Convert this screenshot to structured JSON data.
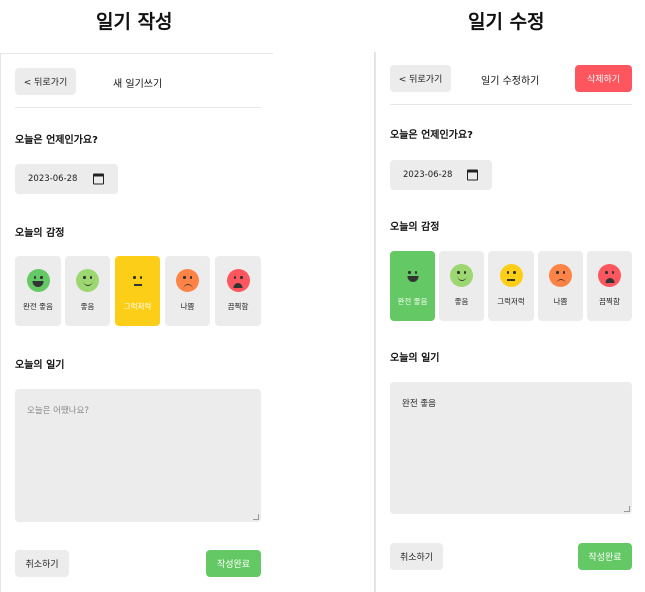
{
  "captions": {
    "new": "일기 작성",
    "edit": "일기 수정"
  },
  "new_page": {
    "back_label": "< 뒤로가기",
    "title": "새 일기쓰기",
    "date_question": "오늘은 언제인가요?",
    "date_value": "2023-06-28",
    "emotion_title": "오늘의 감정",
    "emotions": [
      "완전 좋음",
      "좋음",
      "그럭저럭",
      "나쁨",
      "끔찍함"
    ],
    "selected_emotion": "그럭저럭",
    "diary_title": "오늘의 일기",
    "diary_placeholder": "오늘은 어땠나요?",
    "cancel_label": "취소하기",
    "submit_label": "작성완료"
  },
  "edit_page": {
    "back_label": "< 뒤로가기",
    "title": "일기 수정하기",
    "delete_label": "삭제하기",
    "date_question": "오늘은 언제인가요?",
    "date_value": "2023-06-28",
    "emotion_title": "오늘의 감정",
    "emotions": [
      "완전 좋음",
      "좋음",
      "그럭저럭",
      "나쁨",
      "끔찍함"
    ],
    "selected_emotion": "완전 좋음",
    "diary_title": "오늘의 일기",
    "diary_text": "완전 좋음",
    "cancel_label": "취소하기",
    "submit_label": "작성완료"
  },
  "colors": {
    "emotion_1": "#64c964",
    "emotion_2": "#9dd772",
    "emotion_3": "#fdce17",
    "emotion_4": "#fd8446",
    "emotion_5": "#fd565f",
    "selected_yellow": "#fdce17",
    "selected_green": "#64c964",
    "delete_red": "#fd565f",
    "submit_green": "#64c964"
  }
}
